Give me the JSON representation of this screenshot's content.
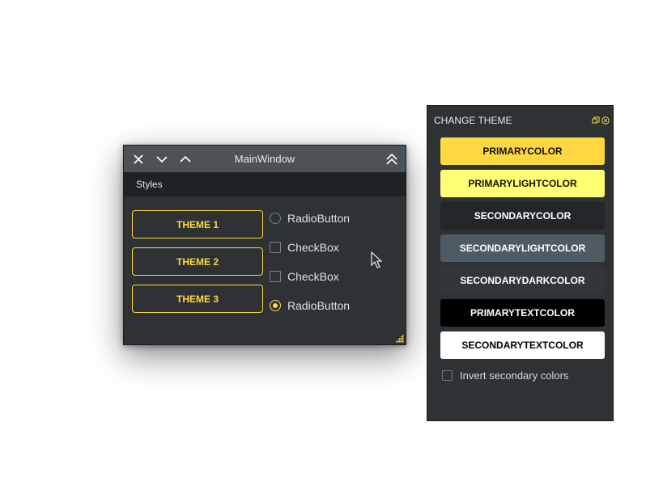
{
  "main_window": {
    "title": "MainWindow",
    "menu": [
      "Styles"
    ],
    "theme_buttons": [
      "THEME 1",
      "THEME 2",
      "THEME 3"
    ],
    "controls": [
      {
        "type": "radio",
        "label": "RadioButton",
        "checked": false
      },
      {
        "type": "checkbox",
        "label": "CheckBox",
        "checked": false
      },
      {
        "type": "checkbox",
        "label": "CheckBox",
        "checked": false
      },
      {
        "type": "radio",
        "label": "RadioButton",
        "checked": true
      }
    ],
    "titlebar_icons": [
      "close-icon",
      "minimize-icon",
      "maximize-icon",
      "shade-icon"
    ]
  },
  "panel": {
    "title": "CHANGE THEME",
    "header_icons": [
      "float-icon",
      "close-circle-icon"
    ],
    "color_buttons": [
      {
        "label": "PRIMARYCOLOR",
        "bg": "#ffd740",
        "fg": "#111111"
      },
      {
        "label": "PRIMARYLIGHTCOLOR",
        "bg": "#ffff74",
        "fg": "#111111"
      },
      {
        "label": "SECONDARYCOLOR",
        "bg": "#232629",
        "fg": "#ffffff"
      },
      {
        "label": "SECONDARYLIGHTCOLOR",
        "bg": "#4f5b62",
        "fg": "#ffffff"
      },
      {
        "label": "SECONDARYDARKCOLOR",
        "bg": "#31363b",
        "fg": "#ffffff"
      },
      {
        "label": "PRIMARYTEXTCOLOR",
        "bg": "#000000",
        "fg": "#ffffff"
      },
      {
        "label": "SECONDARYTEXTCOLOR",
        "bg": "#ffffff",
        "fg": "#000000"
      }
    ],
    "invert_label": "Invert secondary colors",
    "invert_checked": false
  },
  "colors": {
    "accent": "#ffd740",
    "window_bg": "#2f3235",
    "titlebar_bg": "#4c5358",
    "menubar_bg": "#1f2225"
  }
}
